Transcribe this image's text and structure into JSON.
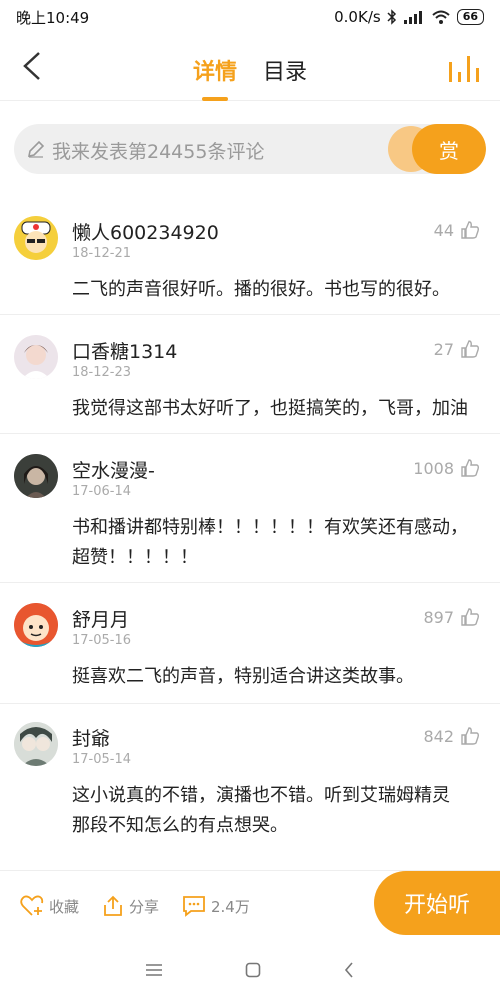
{
  "status": {
    "time": "晚上10:49",
    "speed": "0.0K/s",
    "battery": "66"
  },
  "header": {
    "tabs": [
      "详情",
      "目录"
    ]
  },
  "comment_input": {
    "placeholder": "我来发表第24455条评论",
    "reward_label": "赏"
  },
  "comments": [
    {
      "user": "懒人600234920",
      "date": "18-12-21",
      "likes": "44",
      "text": "二飞的声音很好听。播的很好。书也写的很好。"
    },
    {
      "user": "口香糖1314",
      "date": "18-12-23",
      "likes": "27",
      "text": "我觉得这部书太好听了，也挺搞笑的，飞哥，加油"
    },
    {
      "user": "空水漫漫-",
      "date": "17-06-14",
      "likes": "1008",
      "text_line1": "书和播讲都特别棒！！！！！！有欢笑还有感动，",
      "text_line2": "超赞！！！！！"
    },
    {
      "user": "舒月月",
      "date": "17-05-16",
      "likes": "897",
      "text": "挺喜欢二飞的声音，特别适合讲这类故事。"
    },
    {
      "user": "封爺",
      "date": "17-05-14",
      "likes": "842",
      "text_line1": "这小说真的不错，演播也不错。听到艾瑞姆精灵",
      "text_line2": "那段不知怎么的有点想哭。"
    }
  ],
  "bottom": {
    "favorite": "收藏",
    "share": "分享",
    "comments_count": "2.4万",
    "play": "开始听"
  },
  "colors": {
    "accent": "#f5a11c",
    "gray_text": "#aaaaaa"
  }
}
